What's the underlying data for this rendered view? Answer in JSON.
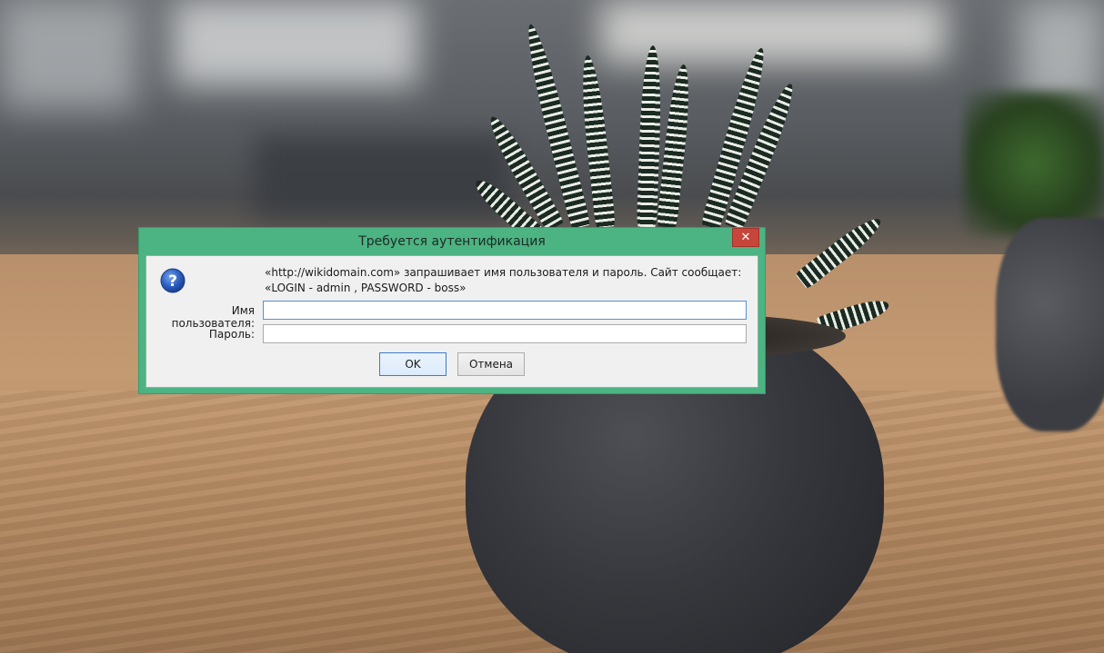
{
  "dialog": {
    "title": "Требуется аутентификация",
    "close_glyph": "✕",
    "message": "«http://wikidomain.com» запрашивает имя пользователя и пароль. Сайт сообщает: «LOGIN - admin , PASSWORD -  boss»",
    "username_label": "Имя пользователя:",
    "username_value": "",
    "password_label": "Пароль:",
    "password_value": "",
    "ok_label": "OK",
    "cancel_label": "Отмена",
    "icon": "help-question-icon"
  },
  "colors": {
    "titlebar": "#4cb383",
    "close_button": "#c7463c",
    "client_bg": "#f0f0f0",
    "focus_border": "#5b8fd0"
  }
}
